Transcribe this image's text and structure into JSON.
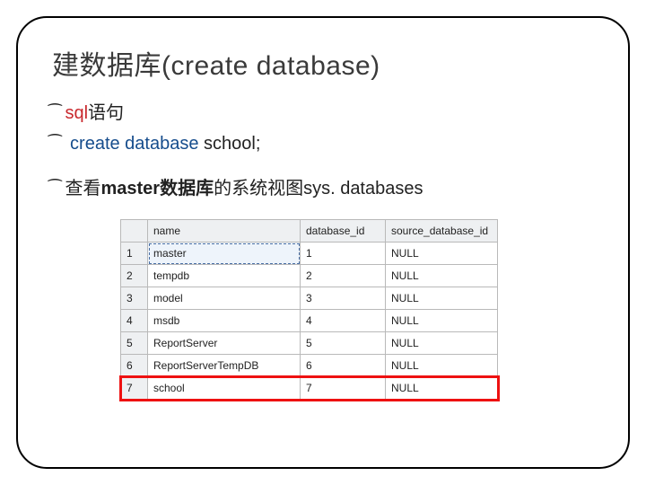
{
  "title": "建数据库(create database)",
  "bullets": {
    "b1_prefix": "sql",
    "b1_rest": "语句",
    "b2_kw": "create database",
    "b2_rest": " school;",
    "b3_pre": "查看",
    "b3_bold": "master数据库",
    "b3_rest": "的系统视图sys. databases"
  },
  "bullet_glyph": "⁀",
  "table": {
    "headers": {
      "name": "name",
      "dbid": "database_id",
      "src": "source_database_id"
    },
    "rows": [
      {
        "n": "1",
        "name": "master",
        "dbid": "1",
        "src": "NULL",
        "selected": true
      },
      {
        "n": "2",
        "name": "tempdb",
        "dbid": "2",
        "src": "NULL"
      },
      {
        "n": "3",
        "name": "model",
        "dbid": "3",
        "src": "NULL"
      },
      {
        "n": "4",
        "name": "msdb",
        "dbid": "4",
        "src": "NULL"
      },
      {
        "n": "5",
        "name": "ReportServer",
        "dbid": "5",
        "src": "NULL"
      },
      {
        "n": "6",
        "name": "ReportServerTempDB",
        "dbid": "6",
        "src": "NULL"
      },
      {
        "n": "7",
        "name": "school",
        "dbid": "7",
        "src": "NULL",
        "highlight": true
      }
    ]
  }
}
